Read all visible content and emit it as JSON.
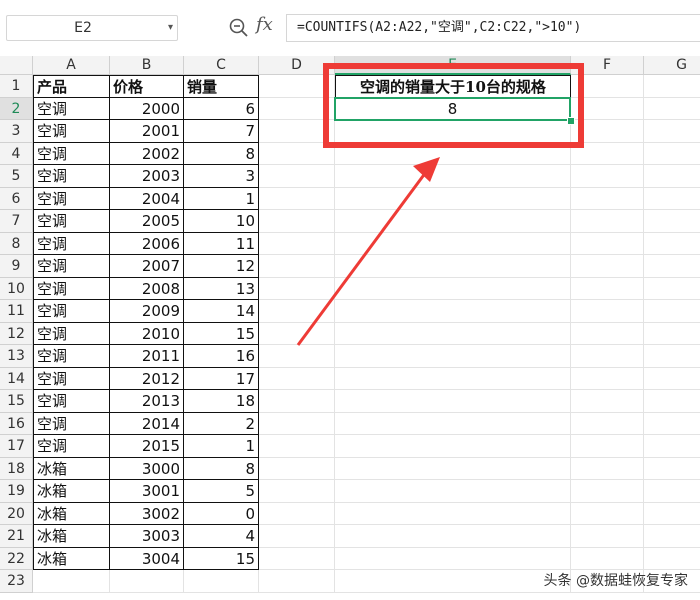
{
  "formula_bar": {
    "name_box": "E2",
    "fx_label": "fx",
    "formula": "=COUNTIFS(A2:A22,\"空调\",C2:C22,\">10\")"
  },
  "columns": [
    "A",
    "B",
    "C",
    "D",
    "E",
    "F",
    "G"
  ],
  "active_column": "E",
  "active_row": "2",
  "rows": [
    "1",
    "2",
    "3",
    "4",
    "5",
    "6",
    "7",
    "8",
    "9",
    "10",
    "11",
    "12",
    "13",
    "14",
    "15",
    "16",
    "17",
    "18",
    "19",
    "20",
    "21",
    "22",
    "23"
  ],
  "table": {
    "headers": [
      "产品",
      "价格",
      "销量"
    ],
    "records": [
      [
        "空调",
        "2000",
        "6"
      ],
      [
        "空调",
        "2001",
        "7"
      ],
      [
        "空调",
        "2002",
        "8"
      ],
      [
        "空调",
        "2003",
        "3"
      ],
      [
        "空调",
        "2004",
        "1"
      ],
      [
        "空调",
        "2005",
        "10"
      ],
      [
        "空调",
        "2006",
        "11"
      ],
      [
        "空调",
        "2007",
        "12"
      ],
      [
        "空调",
        "2008",
        "13"
      ],
      [
        "空调",
        "2009",
        "14"
      ],
      [
        "空调",
        "2010",
        "15"
      ],
      [
        "空调",
        "2011",
        "16"
      ],
      [
        "空调",
        "2012",
        "17"
      ],
      [
        "空调",
        "2013",
        "18"
      ],
      [
        "空调",
        "2014",
        "2"
      ],
      [
        "空调",
        "2015",
        "1"
      ],
      [
        "冰箱",
        "3000",
        "8"
      ],
      [
        "冰箱",
        "3001",
        "5"
      ],
      [
        "冰箱",
        "3002",
        "0"
      ],
      [
        "冰箱",
        "3003",
        "4"
      ],
      [
        "冰箱",
        "3004",
        "15"
      ]
    ]
  },
  "result": {
    "label": "空调的销量大于10台的规格",
    "value": "8"
  },
  "annotation": {
    "highlight_color": "#ee3b36",
    "selection_color": "#21a366"
  },
  "watermark": "头条 @数据蛙恢复专家"
}
